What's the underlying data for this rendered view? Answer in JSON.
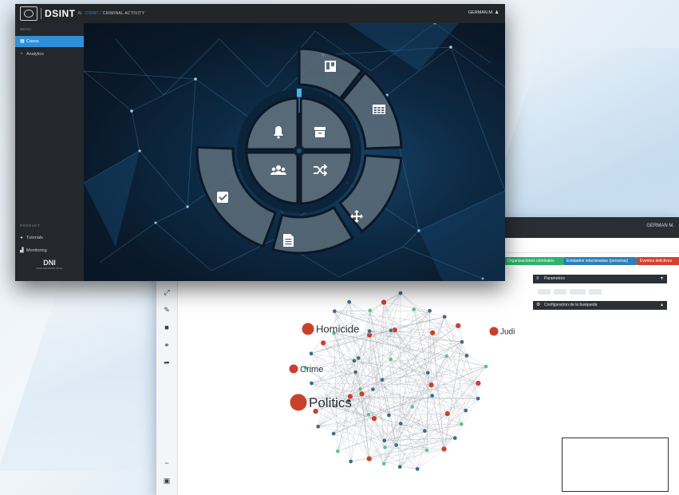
{
  "front_window": {
    "brand": "DSINT",
    "brand_sub": "AI",
    "breadcrumb": {
      "root": "OSINT /",
      "current": "CRIMINAL ACTIVITY"
    },
    "user_name": "GERMAN M.",
    "user_icon": "user-icon",
    "sidebar": {
      "section_main": "MENU",
      "items": [
        {
          "label": "Casos",
          "icon": "dashboard-icon",
          "active": true
        },
        {
          "label": "Analytics",
          "icon": "analytics-icon",
          "active": false
        }
      ],
      "section_bottom": "PRODUCT",
      "bottom_items": [
        {
          "label": "Tutorials",
          "icon": "tutorial-icon"
        },
        {
          "label": "Monitoring",
          "icon": "monitor-icon"
        }
      ],
      "footer_logo": "DNI",
      "footer_logo_sub": "DATA NETWORK INTEL"
    },
    "radial_menu": {
      "inner": [
        {
          "name": "alerts",
          "icon": "bell-icon"
        },
        {
          "name": "archive",
          "icon": "archive-icon"
        },
        {
          "name": "groups",
          "icon": "users-icon"
        },
        {
          "name": "shuffle",
          "icon": "shuffle-icon"
        }
      ],
      "outer": [
        {
          "name": "board",
          "icon": "board-icon"
        },
        {
          "name": "table",
          "icon": "table-icon"
        },
        {
          "name": "move",
          "icon": "move-icon"
        },
        {
          "name": "document",
          "icon": "document-icon"
        },
        {
          "name": "tasks",
          "icon": "checkbox-icon"
        }
      ]
    }
  },
  "back_window": {
    "user_name": "GERMAN M.",
    "tags": [
      {
        "label": "Organizaciones criminales",
        "color": "#2fb36b"
      },
      {
        "label": "Entidades relacionadas (personas)",
        "color": "#2e7fb8"
      },
      {
        "label": "Eventos delictivos",
        "color": "#d5402f"
      }
    ],
    "panels": [
      {
        "label": "Parametros",
        "icon": "filter-icon",
        "caret": "▾"
      },
      {
        "label": "Configuracion de la busqueda",
        "icon": "settings-icon",
        "caret": "▴"
      }
    ],
    "chips": [
      "",
      "",
      "",
      ""
    ],
    "tools": [
      {
        "icon": "expand-icon",
        "glyph": "⤢"
      },
      {
        "icon": "pencil-icon",
        "glyph": "✎"
      },
      {
        "icon": "square-icon",
        "glyph": "■"
      },
      {
        "icon": "link-icon",
        "glyph": "⚭"
      },
      {
        "icon": "share-icon",
        "glyph": "➦"
      },
      {
        "icon": "minus-icon",
        "glyph": "−"
      },
      {
        "icon": "save-icon",
        "glyph": "▣"
      }
    ],
    "graph": {
      "labeled_nodes": [
        {
          "label": "Homicide",
          "kind": "red-large"
        },
        {
          "label": "Judiciary (System of Justice)",
          "kind": "red-medium"
        },
        {
          "label": "Crime",
          "kind": "red-medium"
        },
        {
          "label": "Politics",
          "kind": "red-xlarge"
        }
      ],
      "colors": {
        "red": "#c9412d",
        "green": "#5cc48a",
        "teal": "#3a6b8a",
        "edge": "#9aa0a8"
      }
    }
  }
}
